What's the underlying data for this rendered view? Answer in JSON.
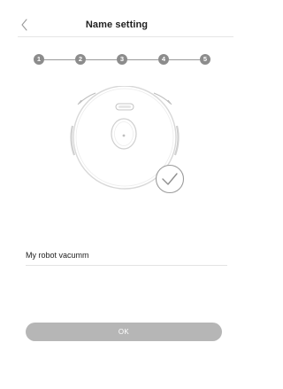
{
  "header": {
    "title": "Name setting",
    "back_icon": "chevron-left-icon"
  },
  "stepper": {
    "steps": [
      "1",
      "2",
      "3",
      "4",
      "5"
    ]
  },
  "illustration": {
    "device_icon": "robot-vacuum-icon",
    "status_icon": "check-circle-icon"
  },
  "form": {
    "name_value": "My robot vacumm"
  },
  "actions": {
    "ok_label": "OK"
  },
  "colors": {
    "step_dot": "#8c8c8c",
    "button_disabled": "#b6b6b6",
    "divider": "#e6e6e6"
  }
}
